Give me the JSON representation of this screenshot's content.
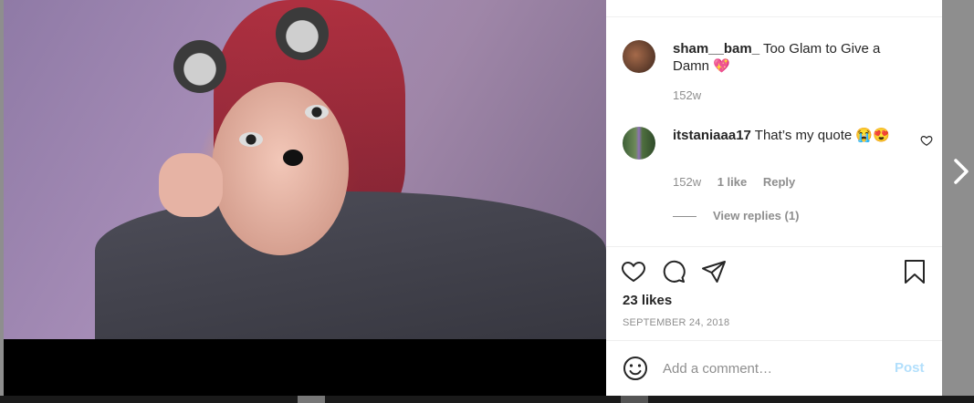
{
  "post": {
    "caption": {
      "username": "sham__bam_",
      "text": " Too Glam to Give a Damn 💖",
      "age": "152w"
    },
    "comments": [
      {
        "username": "itstaniaaa17",
        "text": " That’s my quote 😭😍",
        "age": "152w",
        "likes": "1 like",
        "reply_label": "Reply",
        "view_replies": "View replies (1)"
      }
    ],
    "likes": "23 likes",
    "date": "SEPTEMBER 24, 2018"
  },
  "comment_box": {
    "placeholder": "Add a comment…",
    "post_label": "Post"
  },
  "icons": {
    "like": "heart-icon",
    "comment": "comment-bubble-icon",
    "share": "paper-plane-icon",
    "save": "bookmark-icon",
    "emoji": "smiley-icon",
    "next": "chevron-right-icon",
    "comment_like": "heart-icon"
  },
  "colors": {
    "text": "#262626",
    "muted": "#8e8e8e",
    "post_disabled": "#b2dffc"
  }
}
